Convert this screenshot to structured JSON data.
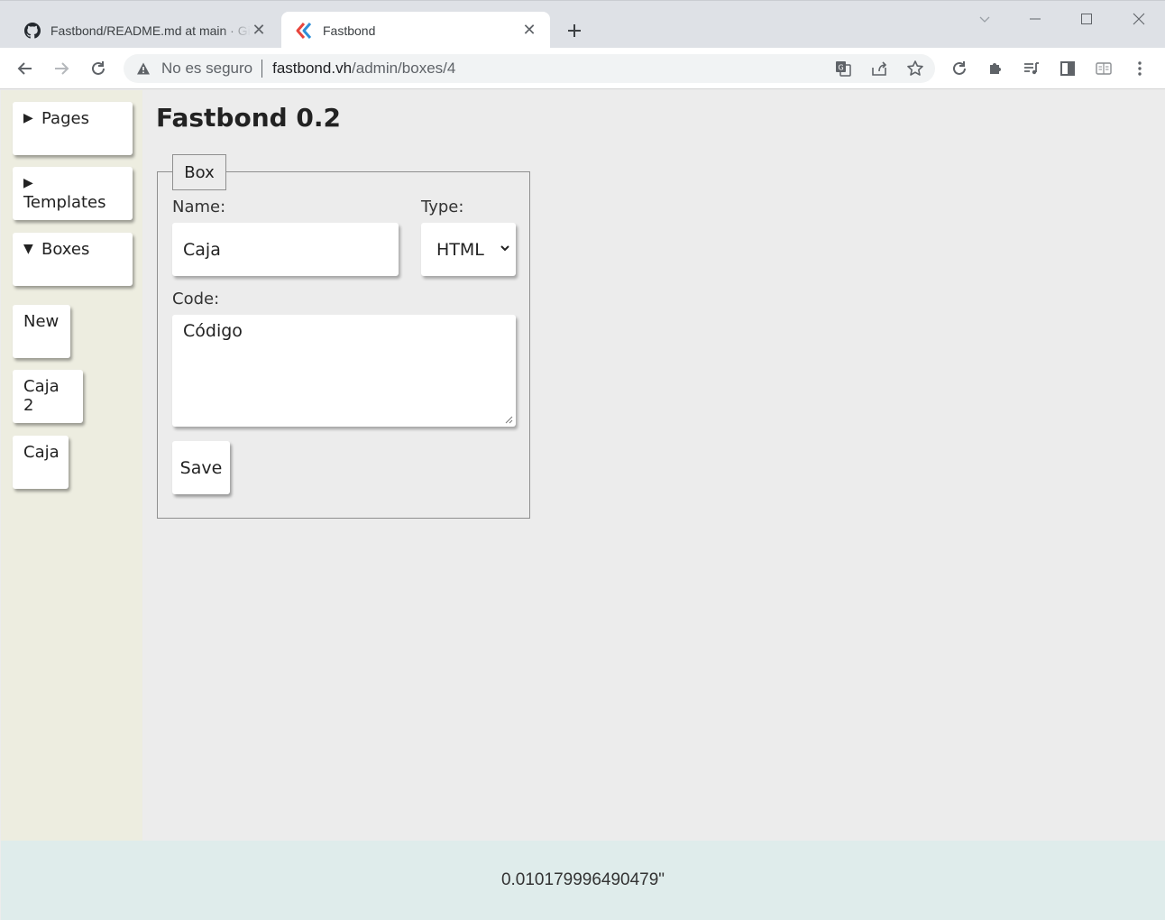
{
  "browser": {
    "tabs": [
      {
        "title": "Fastbond/README.md at main · GitHub",
        "active": false,
        "icon": "github-icon"
      },
      {
        "title": "Fastbond",
        "active": true,
        "icon": "fastbond-icon"
      }
    ],
    "address": {
      "security_label": "No es seguro",
      "host": "fastbond.vh",
      "path": "/admin/boxes/4"
    }
  },
  "sidebar": {
    "sections": [
      {
        "label": "Pages",
        "expanded": false
      },
      {
        "label": "Templates",
        "expanded": false
      },
      {
        "label": "Boxes",
        "expanded": true
      }
    ],
    "items": [
      {
        "label": "New"
      },
      {
        "label": "Caja 2"
      },
      {
        "label": "Caja"
      }
    ]
  },
  "main": {
    "title": "Fastbond 0.2",
    "form": {
      "legend": "Box",
      "name_label": "Name:",
      "name_value": "Caja",
      "type_label": "Type:",
      "type_value": "HTML",
      "code_label": "Code:",
      "code_value": "Código",
      "save_label": "Save"
    }
  },
  "footer": {
    "text": "0.010179996490479\""
  },
  "colors": {
    "sidebar_bg": "#edede0",
    "main_bg": "#ececec",
    "footer_bg": "#dfeceb",
    "fastbond_red": "#e8453c",
    "fastbond_blue": "#2f8fd8"
  }
}
